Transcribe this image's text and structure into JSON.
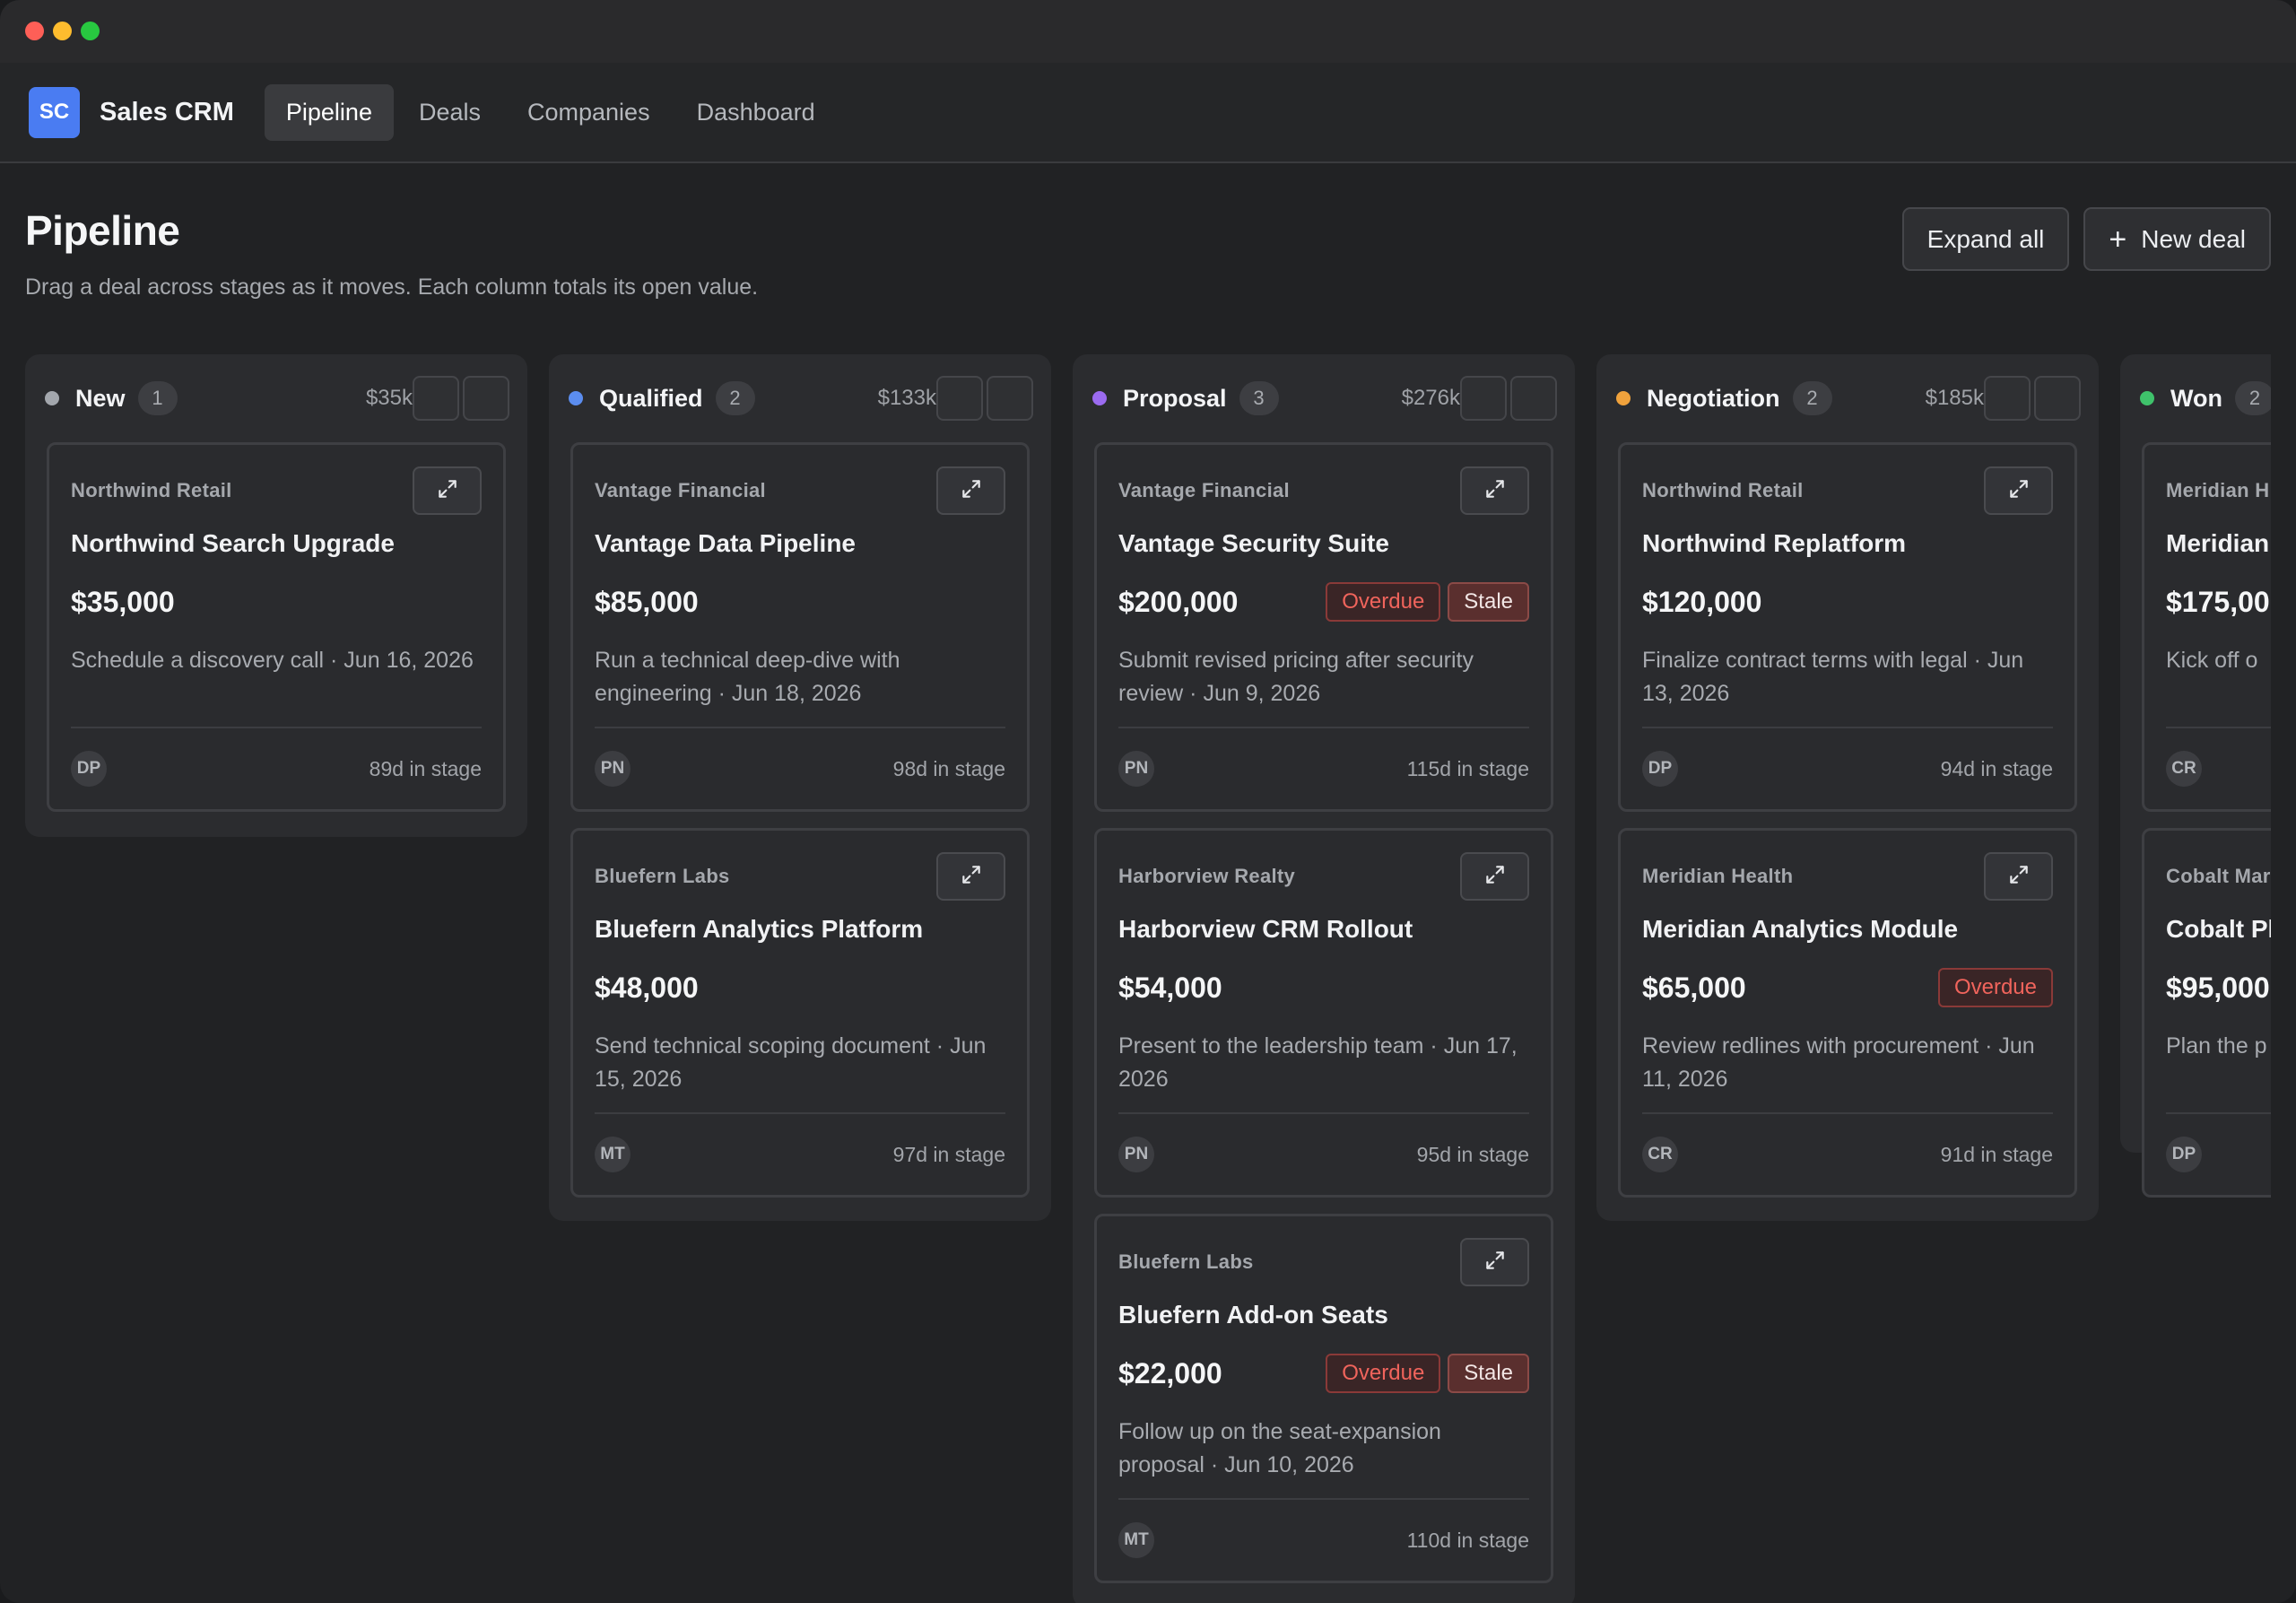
{
  "app": {
    "logo": "SC",
    "name": "Sales CRM"
  },
  "nav": {
    "tabs": [
      {
        "label": "Pipeline",
        "active": true
      },
      {
        "label": "Deals",
        "active": false
      },
      {
        "label": "Companies",
        "active": false
      },
      {
        "label": "Dashboard",
        "active": false
      }
    ]
  },
  "page": {
    "title": "Pipeline",
    "subtitle": "Drag a deal across stages as it moves. Each column totals its open value.",
    "expand_all_label": "Expand all",
    "new_deal_label": "New deal"
  },
  "icons": {
    "expand": "expand-arrows-icon",
    "add": "plus-icon"
  },
  "colors": {
    "new": "#a3a7ad",
    "qualified": "#5b8def",
    "proposal": "#9b6bf0",
    "negotiation": "#f0a23c",
    "won": "#3fc26b",
    "overdue": "#f0645c"
  },
  "columns": [
    {
      "name": "New",
      "count": "1",
      "total": "$35k",
      "cards": [
        {
          "company": "Northwind Retail",
          "title": "Northwind Search Upgrade",
          "amount": "$35,000",
          "overdue": "",
          "stale": "",
          "note": "Schedule a discovery call · Jun 16, 2026",
          "owner": "DP",
          "time": "89d in stage"
        }
      ]
    },
    {
      "name": "Qualified",
      "count": "2",
      "total": "$133k",
      "cards": [
        {
          "company": "Vantage Financial",
          "title": "Vantage Data Pipeline",
          "amount": "$85,000",
          "overdue": "",
          "stale": "",
          "note": "Run a technical deep-dive with engineering · Jun 18, 2026",
          "owner": "PN",
          "time": "98d in stage"
        },
        {
          "company": "Bluefern Labs",
          "title": "Bluefern Analytics Platform",
          "amount": "$48,000",
          "overdue": "",
          "stale": "",
          "note": "Send technical scoping document · Jun 15, 2026",
          "owner": "MT",
          "time": "97d in stage"
        }
      ]
    },
    {
      "name": "Proposal",
      "count": "3",
      "total": "$276k",
      "cards": [
        {
          "company": "Vantage Financial",
          "title": "Vantage Security Suite",
          "amount": "$200,000",
          "overdue": "Overdue",
          "stale": "Stale",
          "note": "Submit revised pricing after security review · Jun 9, 2026",
          "owner": "PN",
          "time": "115d in stage"
        },
        {
          "company": "Harborview Realty",
          "title": "Harborview CRM Rollout",
          "amount": "$54,000",
          "overdue": "",
          "stale": "",
          "note": "Present to the leadership team · Jun 17, 2026",
          "owner": "PN",
          "time": "95d in stage"
        },
        {
          "company": "Bluefern Labs",
          "title": "Bluefern Add-on Seats",
          "amount": "$22,000",
          "overdue": "Overdue",
          "stale": "Stale",
          "note": "Follow up on the seat-expansion proposal · Jun 10, 2026",
          "owner": "MT",
          "time": "110d in stage"
        }
      ]
    },
    {
      "name": "Negotiation",
      "count": "2",
      "total": "$185k",
      "cards": [
        {
          "company": "Northwind Retail",
          "title": "Northwind Replatform",
          "amount": "$120,000",
          "overdue": "",
          "stale": "",
          "note": "Finalize contract terms with legal · Jun 13, 2026",
          "owner": "DP",
          "time": "94d in stage"
        },
        {
          "company": "Meridian Health",
          "title": "Meridian Analytics Module",
          "amount": "$65,000",
          "overdue": "Overdue",
          "stale": "",
          "note": "Review redlines with procurement · Jun 11, 2026",
          "owner": "CR",
          "time": "91d in stage"
        }
      ]
    },
    {
      "name": "Won",
      "count": "2",
      "total": "",
      "cards": [
        {
          "company": "Meridian H",
          "title": "Meridian",
          "amount": "$175,00",
          "overdue": "",
          "stale": "",
          "note": "Kick off o",
          "owner": "CR",
          "time": ""
        },
        {
          "company": "Cobalt Mar",
          "title": "Cobalt Pl",
          "amount": "$95,000",
          "overdue": "",
          "stale": "",
          "note": "Plan the p",
          "owner": "DP",
          "time": ""
        }
      ]
    }
  ]
}
